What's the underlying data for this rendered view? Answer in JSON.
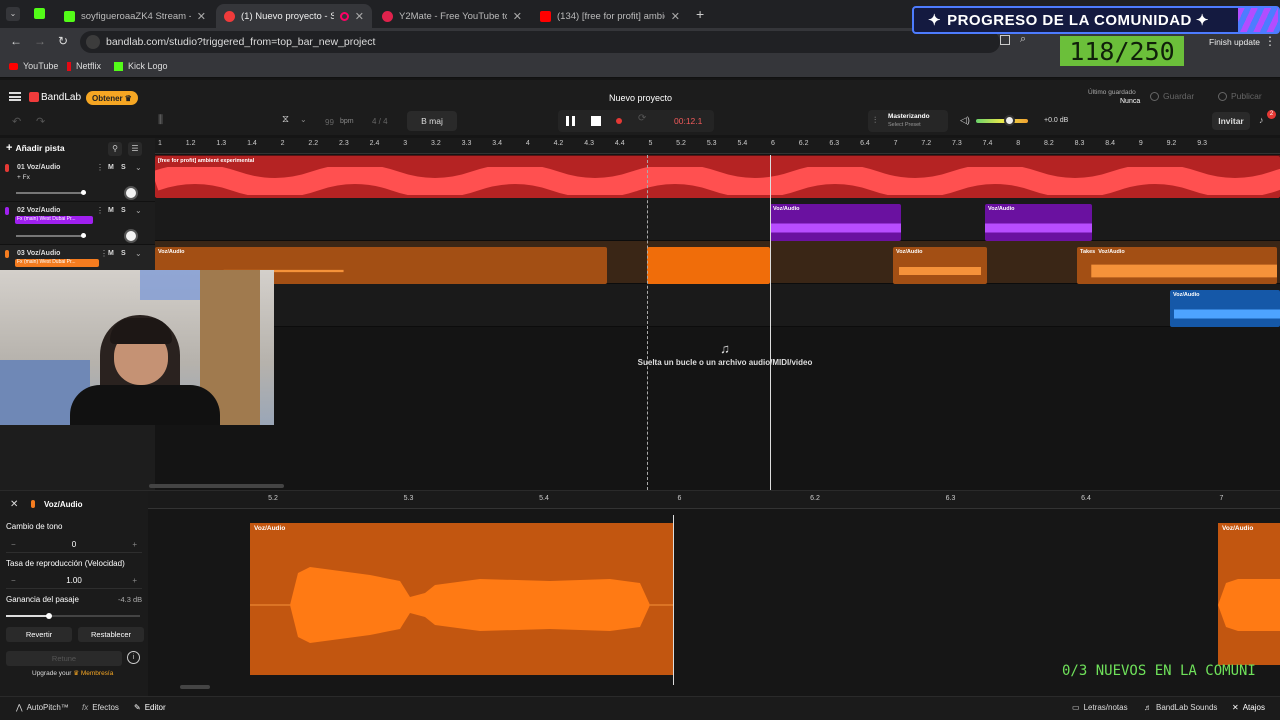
{
  "browser": {
    "tabs": [
      {
        "label": "soyfigueroaaZK4 Stream - Watc",
        "icon": "kick-icon",
        "color": "#53fc18"
      },
      {
        "label": "(1) Nuevo proyecto - Studio",
        "icon": "bandlab-icon",
        "color": "#f03b3b",
        "active": true
      },
      {
        "label": "Y2Mate - Free YouTube to MP3",
        "icon": "y2mate-icon",
        "color": "#e0224c"
      },
      {
        "label": "(134) [free for profit] ambient",
        "icon": "youtube-icon",
        "color": "#ff0000"
      }
    ],
    "url": "bandlab.com/studio?triggered_from=top_bar_new_project",
    "finish_update": "Finish update",
    "bookmarks": [
      "YouTube",
      "Netflix",
      "Kick Logo"
    ]
  },
  "overlay": {
    "community_title": "PROGRESO DE LA COMUNIDAD",
    "community_count": "118/250",
    "ticker": "0/3 NUEVOS EN LA COMUNI"
  },
  "bandlab": {
    "brand": "BandLab",
    "get_badge": "Obtener",
    "project_title": "Nuevo proyecto",
    "last_saved_label": "Último guardado",
    "last_saved_value": "Nunca",
    "save": "Guardar",
    "publish": "Publicar",
    "bpm_value": "99",
    "bpm_unit": "bpm",
    "time_signature": "4 / 4",
    "key": "B maj",
    "time": "00:12.1",
    "mastering_label": "Masterizando",
    "mastering_preset": "Select Preset",
    "volume_db": "+0.0 dB",
    "invite": "Invitar",
    "notif_count": "2",
    "add_track": "Añadir pista",
    "drop_hint": "Suelta un bucle o un archivo audio/MIDI/video"
  },
  "ruler_ticks": [
    "1",
    "1.2",
    "1.3",
    "1.4",
    "2",
    "2.2",
    "2.3",
    "2.4",
    "3",
    "3.2",
    "3.3",
    "3.4",
    "4",
    "4.2",
    "4.3",
    "4.4",
    "5",
    "5.2",
    "5.3",
    "5.4",
    "6",
    "6.2",
    "6.3",
    "6.4",
    "7",
    "7.2",
    "7.3",
    "7.4",
    "8",
    "8.2",
    "8.3",
    "8.4",
    "9",
    "9.2",
    "9.3"
  ],
  "tracks": [
    {
      "num": "01",
      "name": "Voz/Audio",
      "sub": "Fx",
      "color": "#e53935",
      "m": "M",
      "s": "S"
    },
    {
      "num": "02",
      "name": "Voz/Audio",
      "sub": "Fx (main) West Dubai Pr...",
      "color": "#a020f0",
      "m": "M",
      "s": "S"
    },
    {
      "num": "03",
      "name": "Voz/Audio",
      "sub": "Fx (main) West Dubai Pr...",
      "color": "#f57c1f",
      "m": "M",
      "s": "S"
    }
  ],
  "clips": {
    "track1": "[free for profit] ambient  experimental",
    "voz": "Voz/Audio",
    "takes": "Takes"
  },
  "editor": {
    "track_name": "Voz/Audio",
    "pitch_label": "Cambio de tono",
    "pitch_value": "0",
    "speed_label": "Tasa de reproducción (Velocidad)",
    "speed_value": "1.00",
    "gain_label": "Ganancia del pasaje",
    "gain_value": "-4.3 dB",
    "revert": "Revertir",
    "reset": "Restablecer",
    "retune": "Retune",
    "upgrade": "Upgrade your",
    "membership": "Membresía",
    "ticks": [
      "5.2",
      "5.3",
      "5.4",
      "6",
      "6.2",
      "6.3",
      "6.4",
      "7"
    ]
  },
  "bottom": {
    "autopitch": "AutoPitch™",
    "effects": "Efectos",
    "editor": "Editor",
    "lyrics": "Letras/notas",
    "sounds": "BandLab Sounds",
    "shortcuts": "Atajos"
  }
}
